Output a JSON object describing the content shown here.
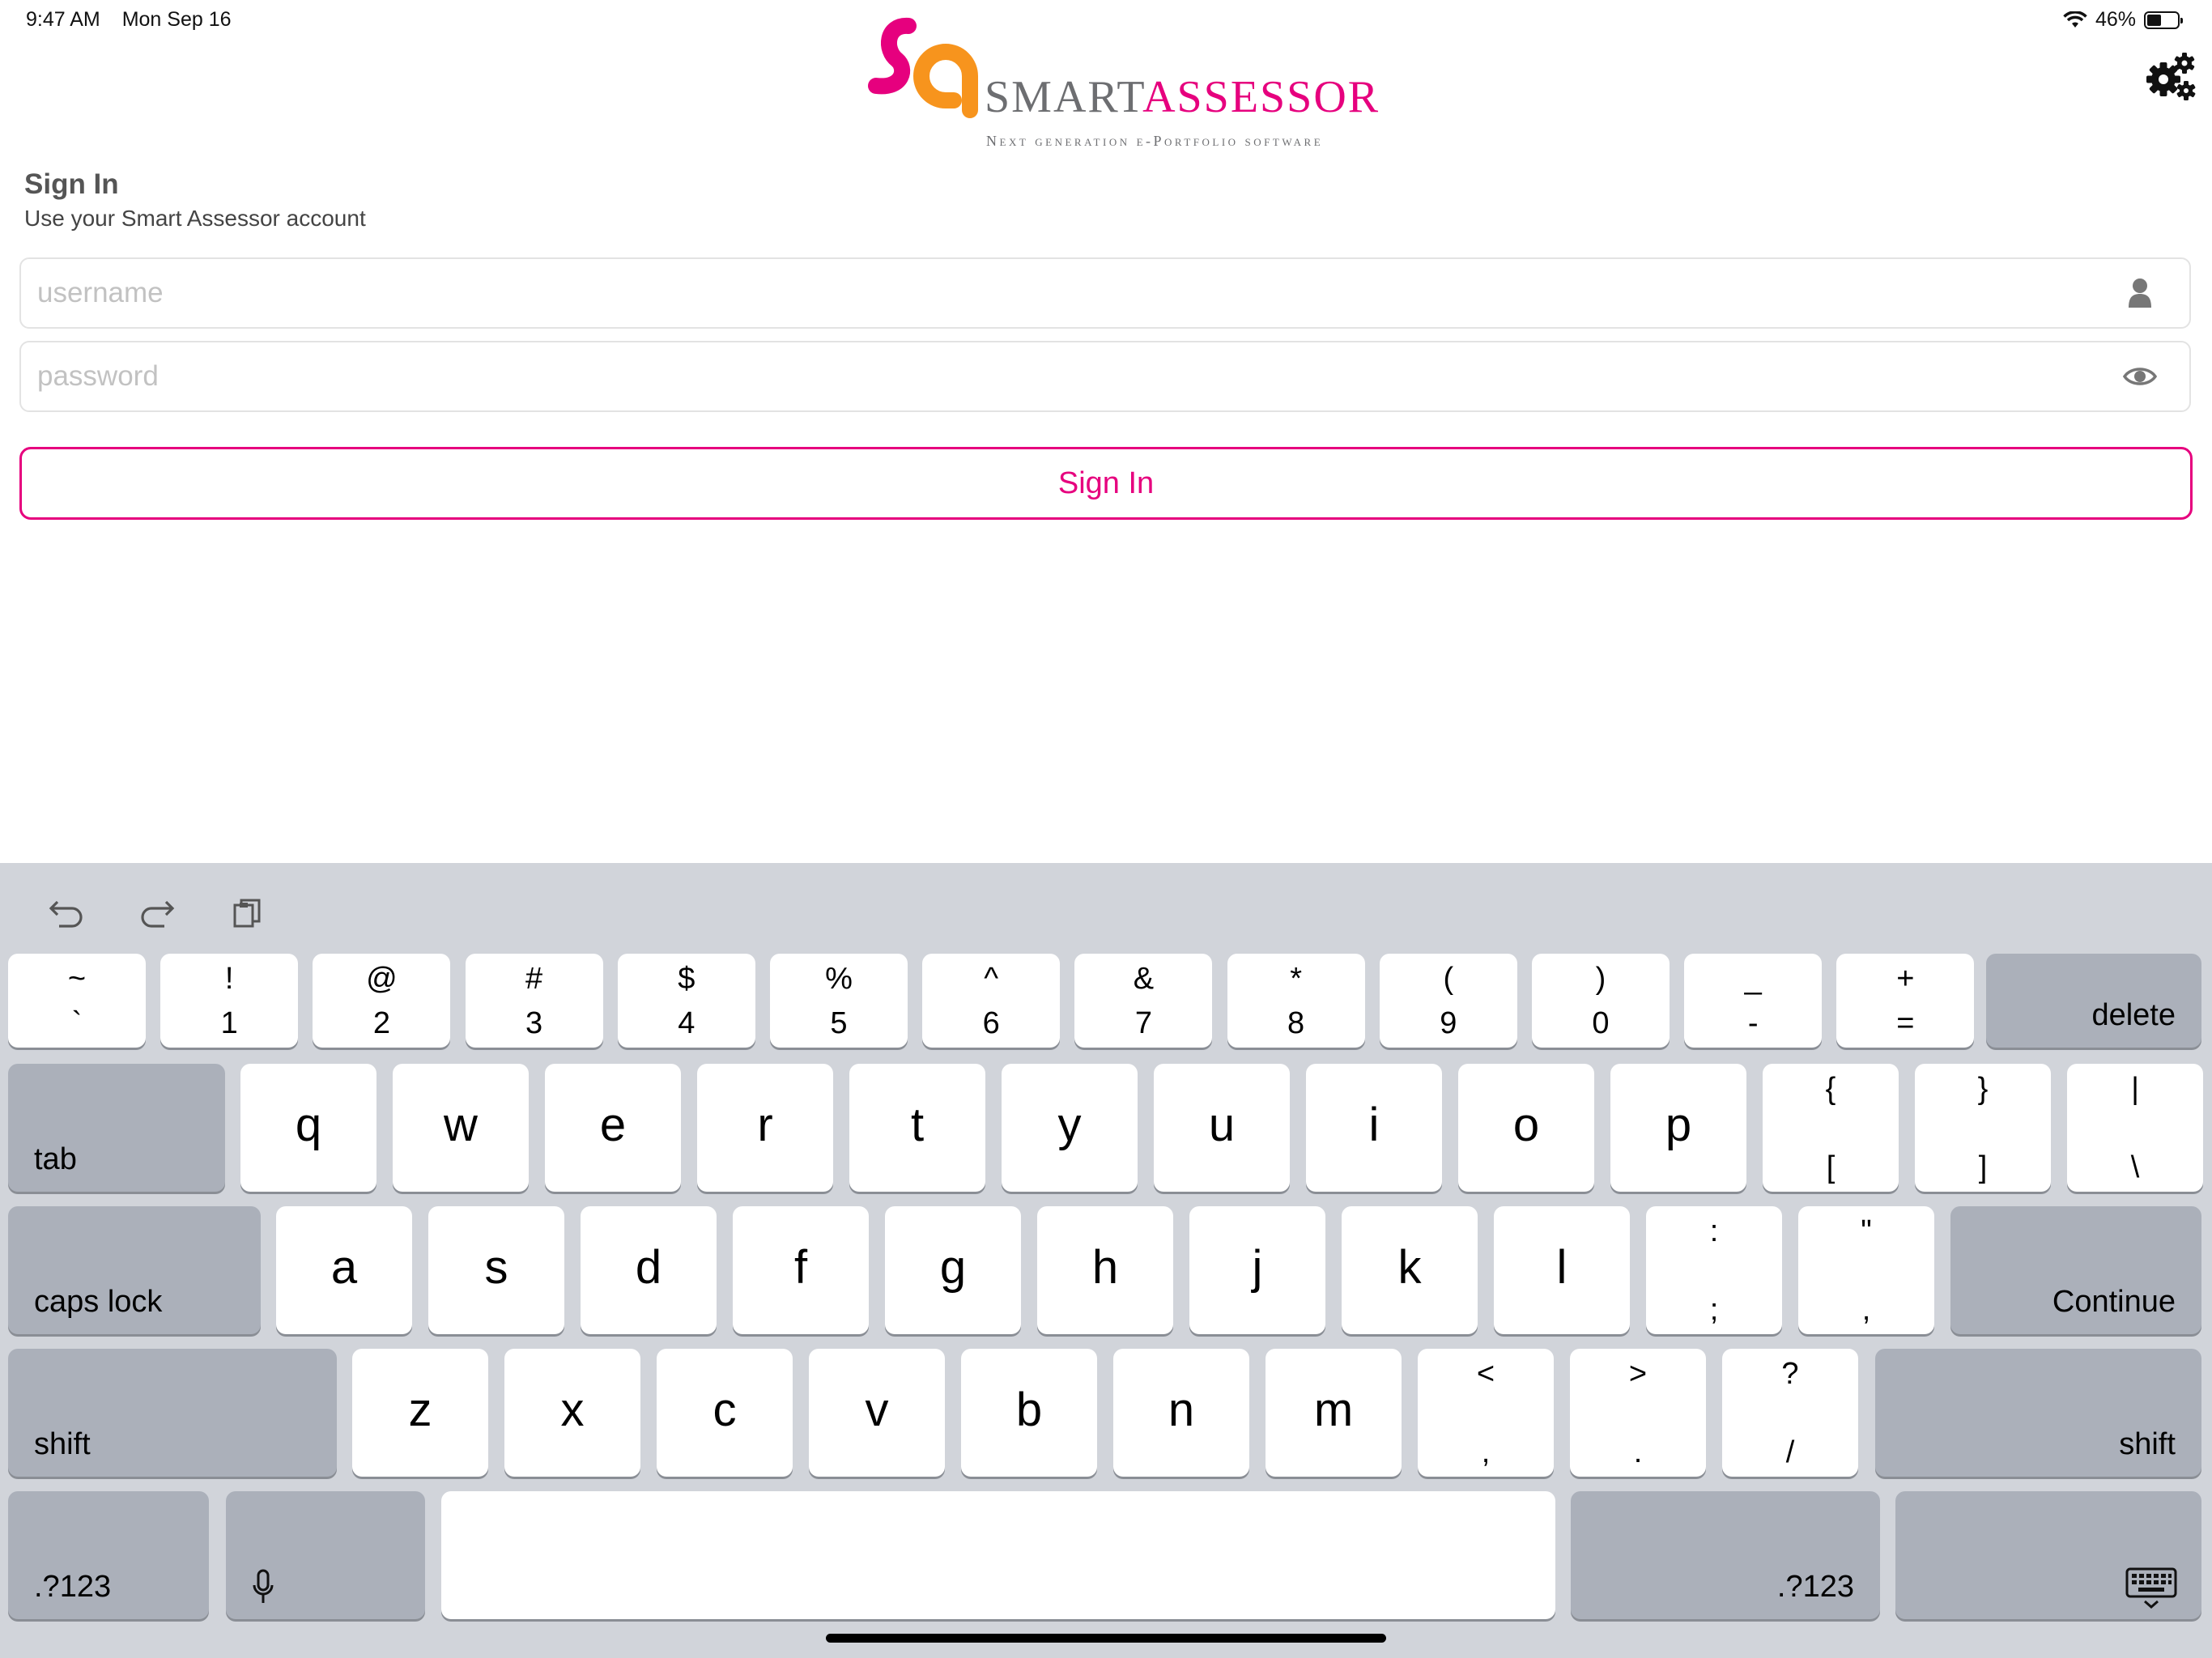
{
  "status_bar": {
    "time": "9:47 AM",
    "date": "Mon Sep 16",
    "battery": "46%",
    "battery_level": 0.46
  },
  "logo": {
    "word1": "SMART",
    "word2": "ASSESSOR",
    "tagline": "Next generation e-Portfolio software"
  },
  "signin": {
    "title": "Sign In",
    "subtitle": "Use your Smart Assessor account",
    "username_placeholder": "username",
    "password_placeholder": "password",
    "button_label": "Sign In"
  },
  "colors": {
    "accent": "#e6007e",
    "orange": "#f7941d",
    "keyboard_bg": "#d1d4da"
  },
  "keyboard": {
    "row1": [
      {
        "top": "~",
        "bottom": "`"
      },
      {
        "top": "!",
        "bottom": "1"
      },
      {
        "top": "@",
        "bottom": "2"
      },
      {
        "top": "#",
        "bottom": "3"
      },
      {
        "top": "$",
        "bottom": "4"
      },
      {
        "top": "%",
        "bottom": "5"
      },
      {
        "top": "^",
        "bottom": "6"
      },
      {
        "top": "&",
        "bottom": "7"
      },
      {
        "top": "*",
        "bottom": "8"
      },
      {
        "top": "(",
        "bottom": "9"
      },
      {
        "top": ")",
        "bottom": "0"
      },
      {
        "top": "_",
        "bottom": "-"
      },
      {
        "top": "+",
        "bottom": "="
      }
    ],
    "delete": "delete",
    "tab": "tab",
    "row2": [
      "q",
      "w",
      "e",
      "r",
      "t",
      "y",
      "u",
      "i",
      "o",
      "p"
    ],
    "row2_symbols": [
      {
        "top": "{",
        "bottom": "["
      },
      {
        "top": "}",
        "bottom": "]"
      },
      {
        "top": "|",
        "bottom": "\\"
      }
    ],
    "caps_lock": "caps lock",
    "row3": [
      "a",
      "s",
      "d",
      "f",
      "g",
      "h",
      "j",
      "k",
      "l"
    ],
    "row3_symbols": [
      {
        "top": ":",
        "bottom": ";"
      },
      {
        "top": "\"",
        "bottom": ","
      }
    ],
    "continue": "Continue",
    "shift": "shift",
    "row4": [
      "z",
      "x",
      "c",
      "v",
      "b",
      "n",
      "m"
    ],
    "row4_symbols": [
      {
        "top": "<",
        "bottom": ","
      },
      {
        "top": ">",
        "bottom": "."
      },
      {
        "top": "?",
        "bottom": "/"
      }
    ],
    "numbers": ".?123"
  }
}
